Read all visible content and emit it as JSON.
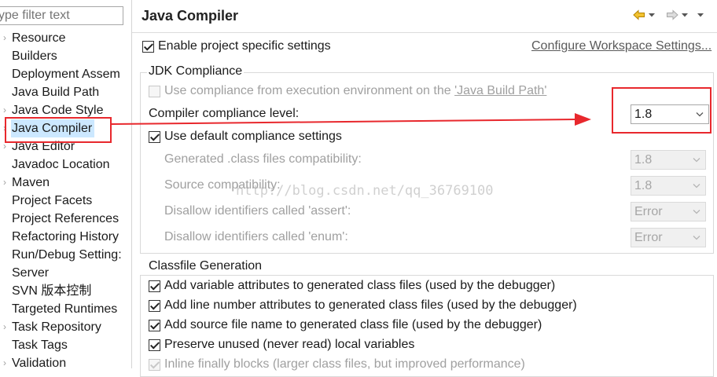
{
  "filter": {
    "placeholder": "ype filter text"
  },
  "nav": {
    "items": [
      {
        "label": "Resource",
        "expandable": true
      },
      {
        "label": "Builders",
        "expandable": false
      },
      {
        "label": "Deployment Assem",
        "expandable": false
      },
      {
        "label": "Java Build Path",
        "expandable": false
      },
      {
        "label": "Java Code Style",
        "expandable": true
      },
      {
        "label": "Java Compiler",
        "expandable": true,
        "selected": true
      },
      {
        "label": "Java Editor",
        "expandable": true
      },
      {
        "label": "Javadoc Location",
        "expandable": false
      },
      {
        "label": "Maven",
        "expandable": true
      },
      {
        "label": "Project Facets",
        "expandable": false
      },
      {
        "label": "Project References",
        "expandable": false
      },
      {
        "label": "Refactoring History",
        "expandable": false
      },
      {
        "label": "Run/Debug Setting:",
        "expandable": false
      },
      {
        "label": "Server",
        "expandable": false
      },
      {
        "label": "SVN 版本控制",
        "expandable": false
      },
      {
        "label": "Targeted Runtimes",
        "expandable": false
      },
      {
        "label": "Task Repository",
        "expandable": true
      },
      {
        "label": "Task Tags",
        "expandable": false
      },
      {
        "label": "Validation",
        "expandable": true
      }
    ]
  },
  "header": {
    "title": "Java Compiler"
  },
  "project_specific": {
    "label": "Enable project specific settings",
    "checked": true
  },
  "configure_link": "Configure Workspace Settings...",
  "jdk": {
    "group_title": "JDK Compliance",
    "use_env_prefix": "Use compliance from execution environment on the ",
    "use_env_link": "'Java Build Path'",
    "use_env_checked": false,
    "compliance_label": "Compiler compliance level:",
    "compliance_value": "1.8",
    "use_default_label": "Use default compliance settings",
    "use_default_checked": true,
    "rows": [
      {
        "label": "Generated .class files compatibility:",
        "value": "1.8"
      },
      {
        "label": "Source compatibility:",
        "value": "1.8"
      },
      {
        "label": "Disallow identifiers called 'assert':",
        "value": "Error"
      },
      {
        "label": "Disallow identifiers called 'enum':",
        "value": "Error"
      }
    ]
  },
  "classfile": {
    "group_title": "Classfile Generation",
    "options": [
      {
        "label": "Add variable attributes to generated class files (used by the debugger)",
        "checked": true,
        "enabled": true
      },
      {
        "label": "Add line number attributes to generated class files (used by the debugger)",
        "checked": true,
        "enabled": true
      },
      {
        "label": "Add source file name to generated class file (used by the debugger)",
        "checked": true,
        "enabled": true
      },
      {
        "label": "Preserve unused (never read) local variables",
        "checked": true,
        "enabled": true
      },
      {
        "label": "Inline finally blocks (larger class files, but improved performance)",
        "checked": true,
        "enabled": false
      }
    ]
  },
  "watermark": "http://blog.csdn.net/qq_36769100",
  "colors": {
    "annotation": "#e8282d",
    "selection": "#cce8ff",
    "nav_arrow": "#d69a00"
  },
  "icons": [
    "back-arrow-icon",
    "forward-arrow-icon",
    "chevron-down-icon",
    "expand-arrow-icon"
  ]
}
